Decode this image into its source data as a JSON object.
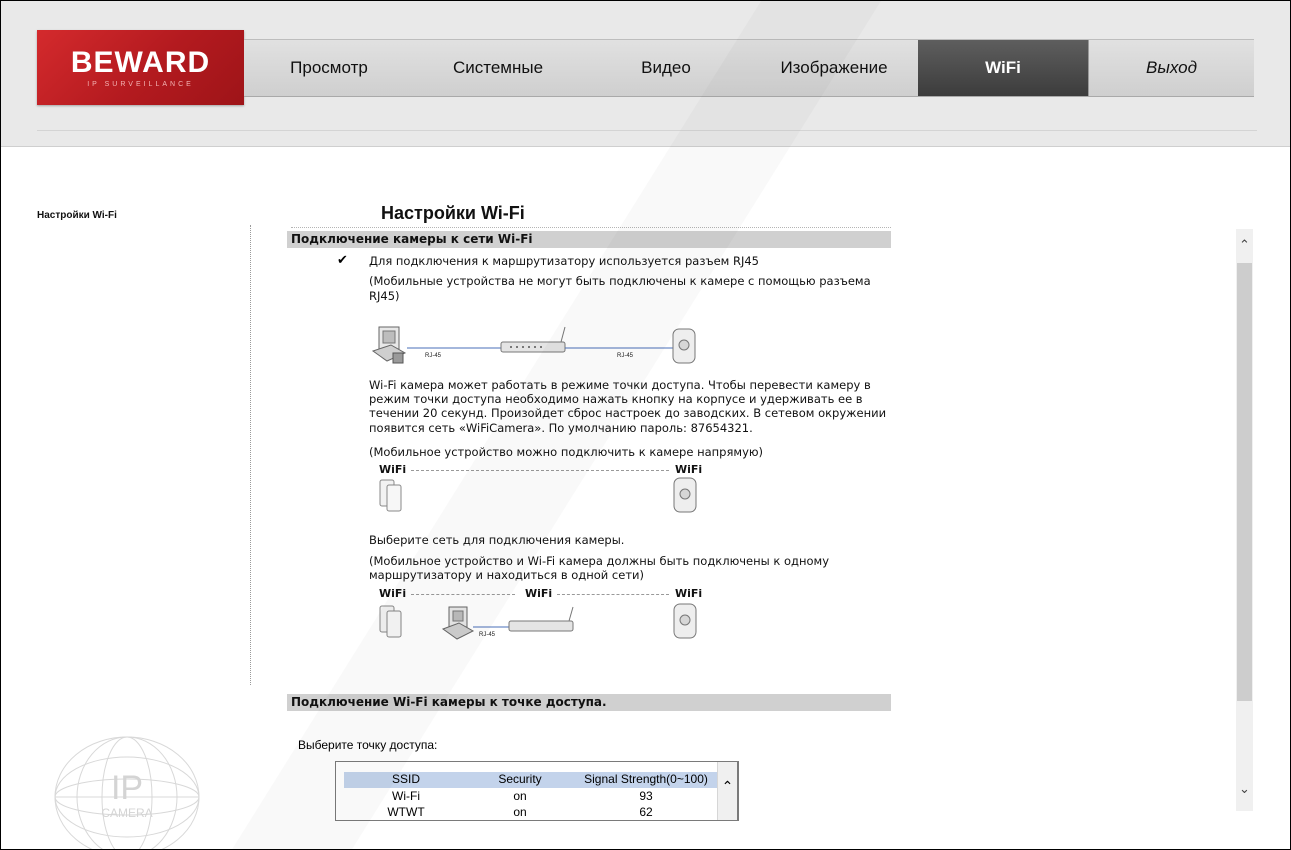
{
  "logo": {
    "brand": "BEWARD",
    "tagline": "IP SURVEILLANCE"
  },
  "nav": {
    "items": [
      "Просмотр",
      "Системные",
      "Видео",
      "Изображение",
      "WiFi",
      "Выход"
    ]
  },
  "sidebar": {
    "link": "Настройки Wi-Fi",
    "ip_logo_text": "IP",
    "ip_logo_sub": "CAMERA"
  },
  "main": {
    "title": "Настройки Wi-Fi",
    "section1": {
      "header": "Подключение камеры к сети Wi-Fi",
      "bullet": "Для подключения к маршрутизатору используется разъем RJ45",
      "note1_line1": "(Мобильные устройства не могут быть подключены к камере с помощью разъема",
      "note1_line2": "RJ45)",
      "rj45_left": "RJ-45",
      "rj45_right": "RJ-45",
      "ap_mode_line1": "Wi-Fi камера может работать в режиме точки доступа. Чтобы перевести камеру в",
      "ap_mode_line2": "режим точки доступа необходимо нажать кнопку на корпусе и удерживать ее в",
      "ap_mode_line3": "течении 20 секунд. Произойдет сброс настроек до заводских. В сетевом окружении",
      "ap_mode_line4": "появится сеть «WiFiCamera». По умолчанию пароль: 87654321.",
      "note2": "(Мобильное устройство можно подключить к камере напрямую)",
      "wifi_a": "WiFi",
      "wifi_b": "WiFi",
      "select_net": "Выберите сеть для подключения камеры.",
      "note3_line1": "(Мобильное устройство и Wi-Fi камера должны быть подключены к одному",
      "note3_line2": "маршрутизатору и находиться в одной сети)",
      "wifi_c": "WiFi",
      "wifi_d": "WiFi",
      "wifi_e": "WiFi",
      "rj45_bottom": "RJ-45"
    },
    "section2": {
      "header": "Подключение Wi-Fi камеры к точке доступа.",
      "select_ap": "Выберите точку доступа:",
      "table": {
        "headers": [
          "SSID",
          "Security",
          "Signal Strength(0~100)"
        ],
        "rows": [
          [
            "Wi-Fi",
            "on",
            "93"
          ],
          [
            "WTWT",
            "on",
            "62"
          ]
        ]
      }
    }
  },
  "colors": {
    "brand_red": "#c8202a",
    "nav_active": "#4a4a4a",
    "section_bar": "#d0d0d0",
    "table_header": "#c3d3eb"
  },
  "icons": [
    "check-icon",
    "chevron-up-icon",
    "chevron-down-icon",
    "pc-icon",
    "router-icon",
    "camera-icon",
    "phone-icon"
  ]
}
